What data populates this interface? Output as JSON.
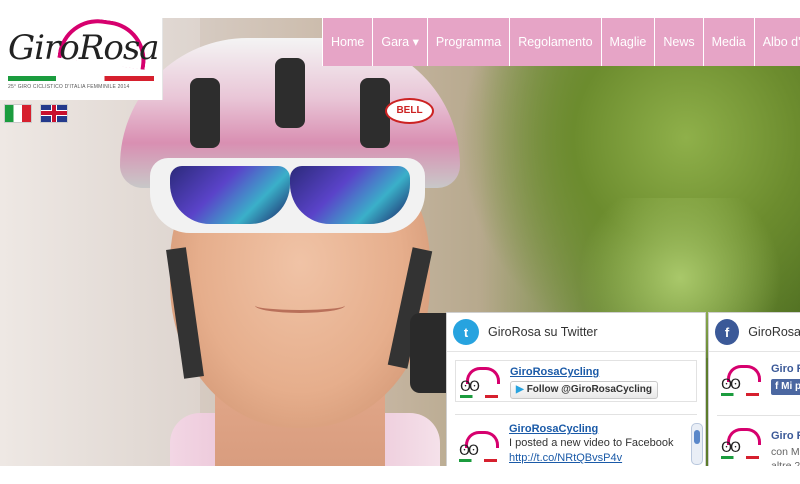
{
  "brand": {
    "logo_text": "GiroRosa",
    "tagline": "25° GIRO CICLISTICO D'ITALIA FEMMINILE 2014"
  },
  "languages": [
    {
      "name": "Italiano",
      "icon": "italy-flag-icon"
    },
    {
      "name": "English",
      "icon": "uk-flag-icon"
    }
  ],
  "nav": {
    "items": [
      {
        "label": "Home"
      },
      {
        "label": "Gara ▾"
      },
      {
        "label": "Programma"
      },
      {
        "label": "Regolamento"
      },
      {
        "label": "Maglie"
      },
      {
        "label": "News"
      },
      {
        "label": "Media"
      },
      {
        "label": "Albo d'oro"
      }
    ]
  },
  "hero": {
    "helmet_brand": "BELL"
  },
  "twitter_widget": {
    "title": "GiroRosa su Twitter",
    "account_name": "GiroRosaCycling",
    "follow_label": "Follow @GiroRosaCycling",
    "tweet": {
      "author": "GiroRosaCycling",
      "text": "I posted a new video to Facebook",
      "link": "http://t.co/NRtQBvsP4v"
    }
  },
  "facebook_widget": {
    "title": "GiroRosa",
    "page_name": "Giro Ro",
    "like_label": "Mi p",
    "post": {
      "author": "Giro R",
      "line1": "con M",
      "line2": "altre 2"
    }
  },
  "colors": {
    "nav_bg": "#e6a4c6",
    "brand_pink": "#d6006e",
    "twitter_blue": "#27a3df",
    "facebook_blue": "#3b5998"
  }
}
